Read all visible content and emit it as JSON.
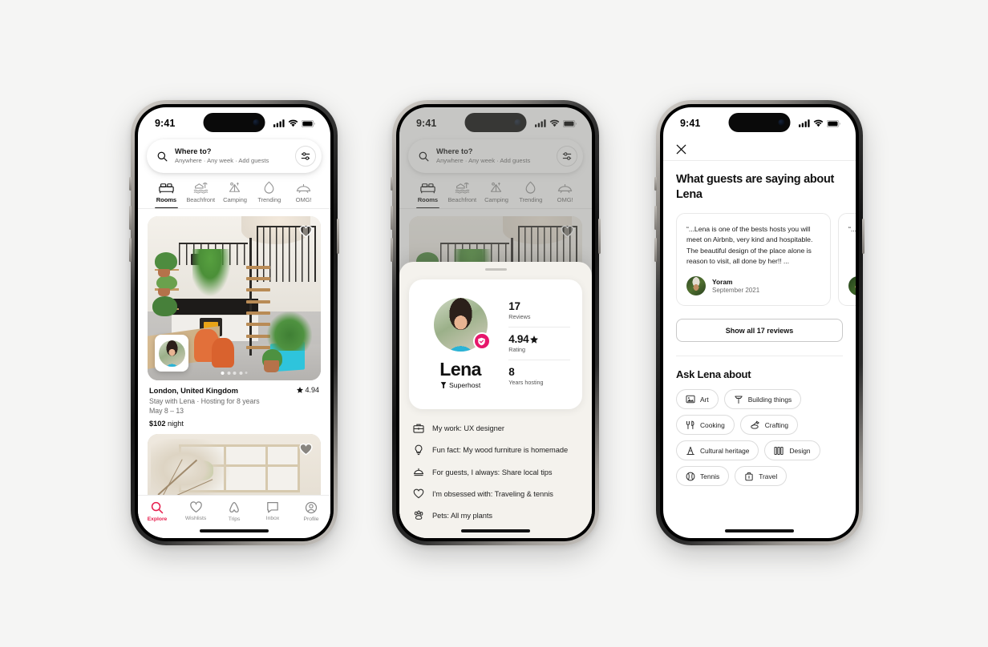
{
  "status_bar": {
    "time": "9:41",
    "signal_icon": "cellular-signal-icon",
    "wifi_icon": "wifi-icon",
    "battery_icon": "battery-icon"
  },
  "search": {
    "icon": "search-icon",
    "title": "Where to?",
    "subtitle": "Anywhere · Any week · Add guests",
    "filter_icon": "filter-sliders-icon"
  },
  "categories": [
    {
      "label": "Rooms",
      "icon": "rooms-icon",
      "active": true
    },
    {
      "label": "Beachfront",
      "icon": "beachfront-icon",
      "active": false
    },
    {
      "label": "Camping",
      "icon": "camping-icon",
      "active": false
    },
    {
      "label": "Trending",
      "icon": "flame-icon",
      "active": false
    },
    {
      "label": "OMG!",
      "icon": "omg-icon",
      "active": false
    }
  ],
  "listing": {
    "title": "London, United Kingdom",
    "rating": "4.94",
    "star_icon": "star-icon",
    "host_line": "Stay with Lena · Hosting for 8 years",
    "dates": "May 8 – 13",
    "price": "$102",
    "price_unit": "night",
    "heart_icon": "heart-icon",
    "photo_dots": 5,
    "active_dot": 1
  },
  "tabbar": [
    {
      "label": "Explore",
      "icon": "search-icon",
      "active": true
    },
    {
      "label": "Wishlists",
      "icon": "heart-outline-icon",
      "active": false
    },
    {
      "label": "Trips",
      "icon": "airbnb-belo-icon",
      "active": false
    },
    {
      "label": "Inbox",
      "icon": "message-icon",
      "active": false
    },
    {
      "label": "Profile",
      "icon": "account-circle-icon",
      "active": false
    }
  ],
  "profile_sheet": {
    "drag_handle": "sheet-drag-handle",
    "name": "Lena",
    "superhost_label": "Superhost",
    "superhost_icon": "superhost-badge-icon",
    "verified_icon": "verified-shield-icon",
    "stats": [
      {
        "value": "17",
        "label": "Reviews"
      },
      {
        "value": "4.94",
        "label": "Rating",
        "suffix_icon": "star-icon"
      },
      {
        "value": "8",
        "label": "Years hosting"
      }
    ],
    "facts": [
      {
        "icon": "briefcase-icon",
        "text": "My work: UX designer"
      },
      {
        "icon": "lightbulb-icon",
        "text": "Fun fact: My wood furniture is homemade"
      },
      {
        "icon": "bell-icon",
        "text": "For guests, I always: Share local tips"
      },
      {
        "icon": "heart-outline-icon",
        "text": "I'm obsessed with: Traveling & tennis"
      },
      {
        "icon": "paw-icon",
        "text": "Pets: All my plants"
      }
    ]
  },
  "reviews_page": {
    "close_icon": "close-icon",
    "title": "What guests are saying about Lena",
    "cards": [
      {
        "text": "“...Lena is one of the bests hosts you will meet on Airbnb, very kind and hospitable. The beautiful design of the place alone is reason to visit, all done by her!! ...",
        "author": "Yoram",
        "date": "September 2021"
      },
      {
        "text": "“...T des can sho"
      }
    ],
    "show_all_label": "Show all 17 reviews",
    "ask_title": "Ask Lena about",
    "chips": [
      {
        "label": "Art",
        "icon": "art-frame-icon"
      },
      {
        "label": "Building things",
        "icon": "hammer-icon"
      },
      {
        "label": "Cooking",
        "icon": "cutlery-icon"
      },
      {
        "label": "Crafting",
        "icon": "crafting-icon"
      },
      {
        "label": "Cultural heritage",
        "icon": "monument-icon"
      },
      {
        "label": "Design",
        "icon": "design-books-icon"
      },
      {
        "label": "Tennis",
        "icon": "tennis-ball-icon"
      },
      {
        "label": "Travel",
        "icon": "suitcase-icon"
      }
    ]
  },
  "colors": {
    "brand": "#e61e4d",
    "verified": "#e6176b",
    "background": "#f5f5f4",
    "sheet": "#f4f2ed"
  }
}
